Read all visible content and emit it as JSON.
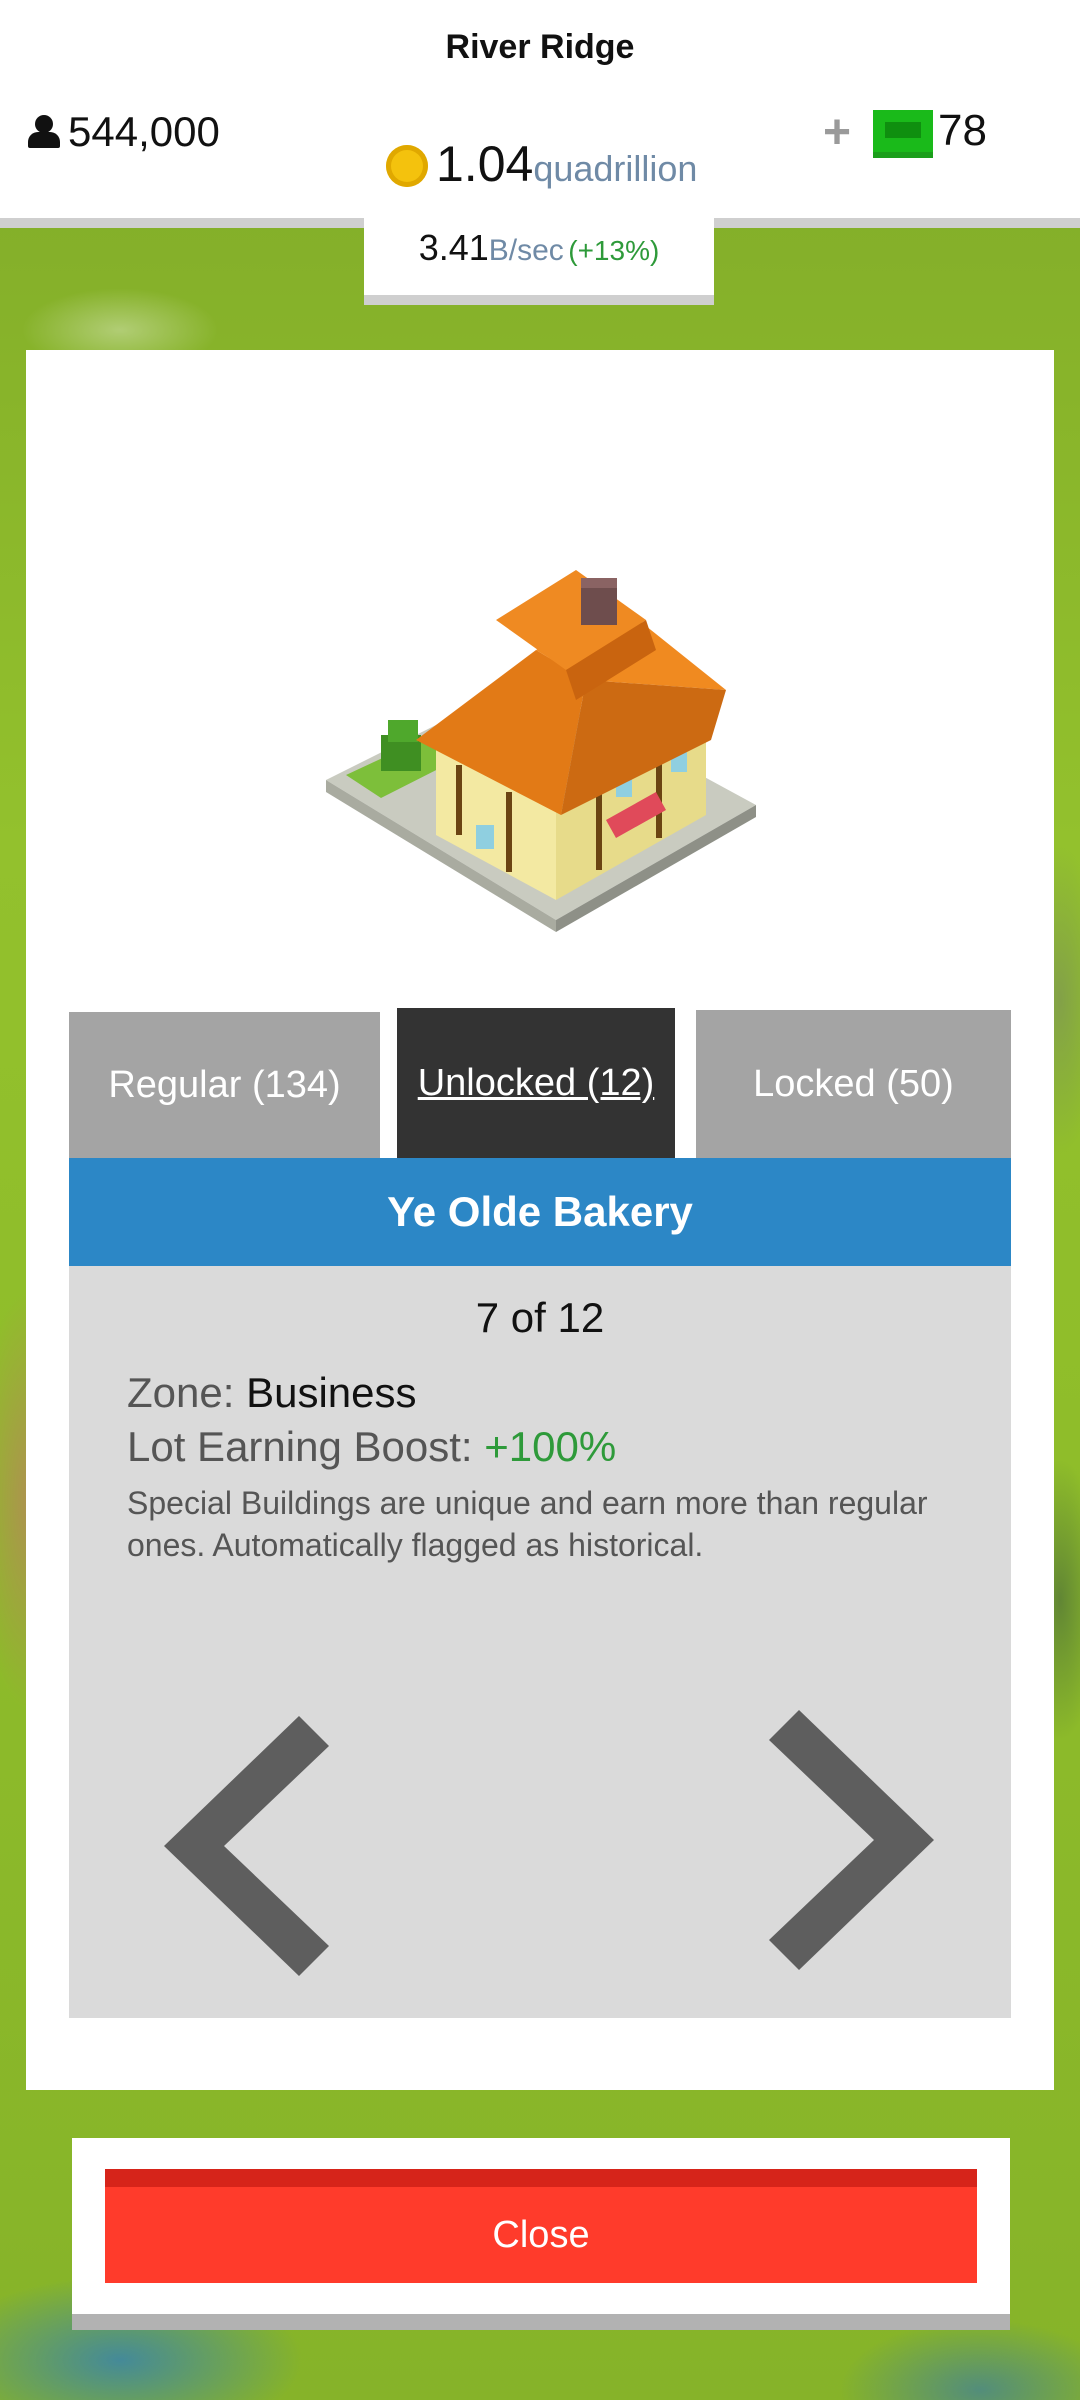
{
  "header": {
    "city_name": "River Ridge",
    "population": "544,000",
    "cash_amount": "1.04",
    "cash_unit": "quadrillion",
    "plus_label": "+",
    "premium_count": "78",
    "income_amount": "3.41",
    "income_unit": "B/sec",
    "income_boost": "(+13%)"
  },
  "tabs": [
    {
      "label": "Regular (134)",
      "active": false
    },
    {
      "label": "Unlocked (12)",
      "active": true
    },
    {
      "label": "Locked (50)",
      "active": false
    }
  ],
  "building": {
    "name": "Ye Olde Bakery",
    "counter": "7 of 12",
    "zone_label": "Zone:",
    "zone_value": "Business",
    "boost_label": "Lot Earning Boost:",
    "boost_value": "+100%",
    "description": "Special Buildings are unique and earn more than regular ones. Automatically flagged as historical."
  },
  "icons": {
    "population": "person-icon",
    "cash": "coin-icon",
    "premium": "cash-bill-icon",
    "prev": "chevron-left-icon",
    "next": "chevron-right-icon"
  },
  "colors": {
    "title_bar": "#2c87c6",
    "close_button": "#ff3b2b",
    "boost_green": "#2e9a3a",
    "active_tab": "#333333",
    "inactive_tab": "#a4a4a4"
  },
  "footer": {
    "close_label": "Close"
  }
}
